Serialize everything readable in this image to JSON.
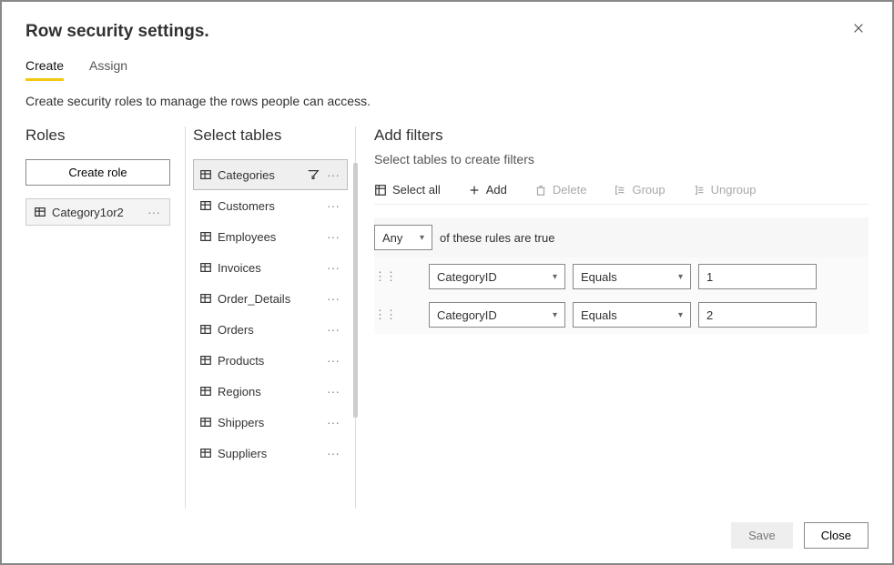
{
  "dialog": {
    "title": "Row security settings.",
    "description": "Create security roles to manage the rows people can access."
  },
  "tabs": [
    {
      "label": "Create",
      "active": true
    },
    {
      "label": "Assign",
      "active": false
    }
  ],
  "panels": {
    "roles_heading": "Roles",
    "tables_heading": "Select tables",
    "filters_heading": "Add filters",
    "filters_sub": "Select tables to create filters"
  },
  "roles": {
    "create_button": "Create role",
    "items": [
      {
        "name": "Category1or2"
      }
    ]
  },
  "tables": [
    {
      "name": "Categories",
      "selected": true,
      "filtered": true
    },
    {
      "name": "Customers",
      "selected": false,
      "filtered": false
    },
    {
      "name": "Employees",
      "selected": false,
      "filtered": false
    },
    {
      "name": "Invoices",
      "selected": false,
      "filtered": false
    },
    {
      "name": "Order_Details",
      "selected": false,
      "filtered": false
    },
    {
      "name": "Orders",
      "selected": false,
      "filtered": false
    },
    {
      "name": "Products",
      "selected": false,
      "filtered": false
    },
    {
      "name": "Regions",
      "selected": false,
      "filtered": false
    },
    {
      "name": "Shippers",
      "selected": false,
      "filtered": false
    },
    {
      "name": "Suppliers",
      "selected": false,
      "filtered": false
    }
  ],
  "toolbar": {
    "select_all": "Select all",
    "add": "Add",
    "delete": "Delete",
    "group": "Group",
    "ungroup": "Ungroup"
  },
  "combiner": {
    "mode": "Any",
    "suffix": "of these rules are true"
  },
  "rules": [
    {
      "field": "CategoryID",
      "operator": "Equals",
      "value": "1"
    },
    {
      "field": "CategoryID",
      "operator": "Equals",
      "value": "2"
    }
  ],
  "footer": {
    "save": "Save",
    "close": "Close"
  }
}
